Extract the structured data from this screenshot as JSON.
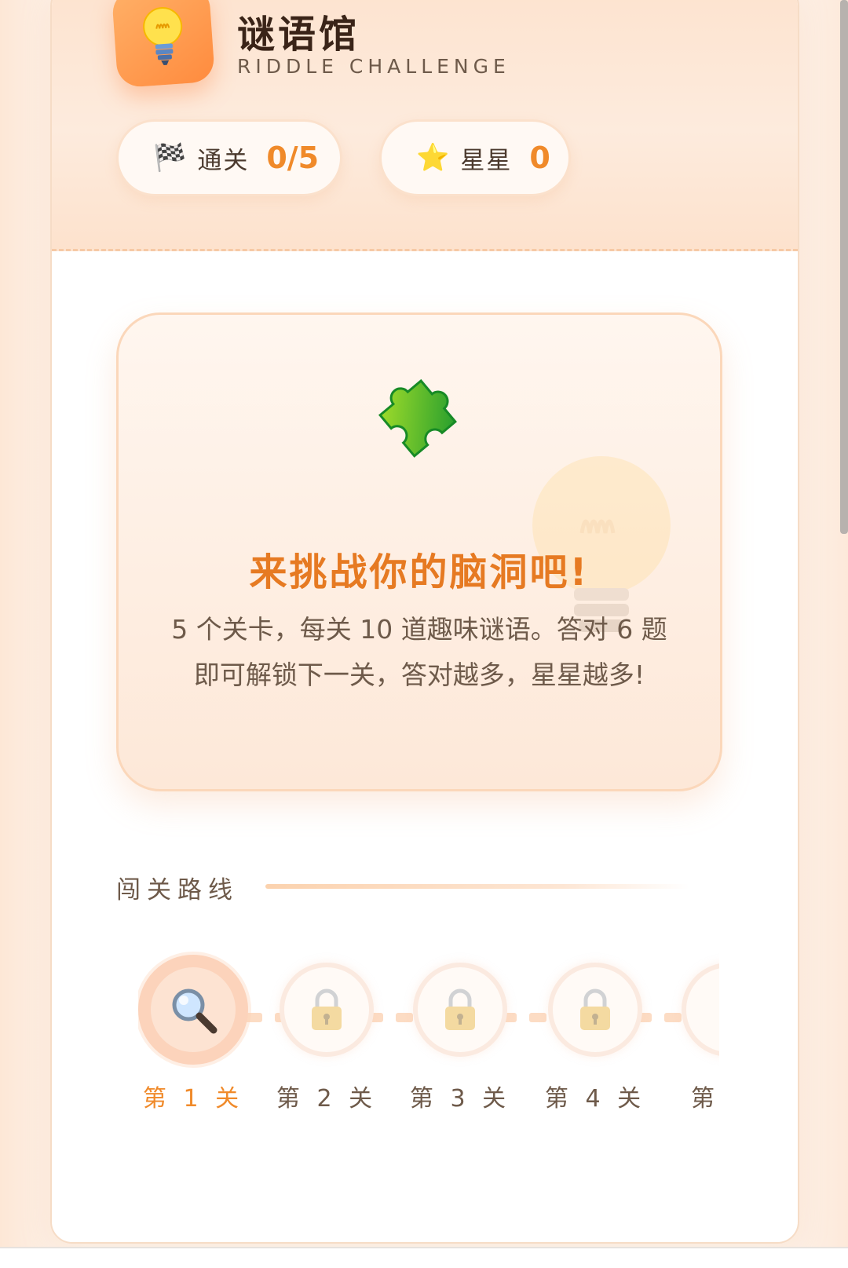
{
  "header": {
    "title": "谜语馆",
    "subtitle": "RIDDLE CHALLENGE",
    "icon": "lightbulb-icon"
  },
  "stats": {
    "pass": {
      "emoji": "🏁",
      "label": "通关",
      "value": "0/5"
    },
    "stars": {
      "emoji": "⭐",
      "label": "星星",
      "value": "0"
    }
  },
  "intro": {
    "icon": "puzzle-icon",
    "heading": "来挑战你的脑洞吧!",
    "body": "5 个关卡，每关 10 道趣味谜语。答对 6 题即可解锁下一关，答对越多，星星越多!"
  },
  "route": {
    "title": "闯关路线",
    "levels": [
      {
        "label": "第 1 关",
        "state": "current",
        "icon": "magnifier-icon"
      },
      {
        "label": "第 2 关",
        "state": "locked",
        "icon": "lock-icon"
      },
      {
        "label": "第 3 关",
        "state": "locked",
        "icon": "lock-icon"
      },
      {
        "label": "第 4 关",
        "state": "locked",
        "icon": "lock-icon"
      },
      {
        "label": "第",
        "state": "locked",
        "icon": "lock-icon"
      }
    ]
  },
  "colors": {
    "accent": "#f08a2a",
    "heading": "#e67a22",
    "header_bg": "#fde3cf",
    "border": "#fbd7ba"
  }
}
